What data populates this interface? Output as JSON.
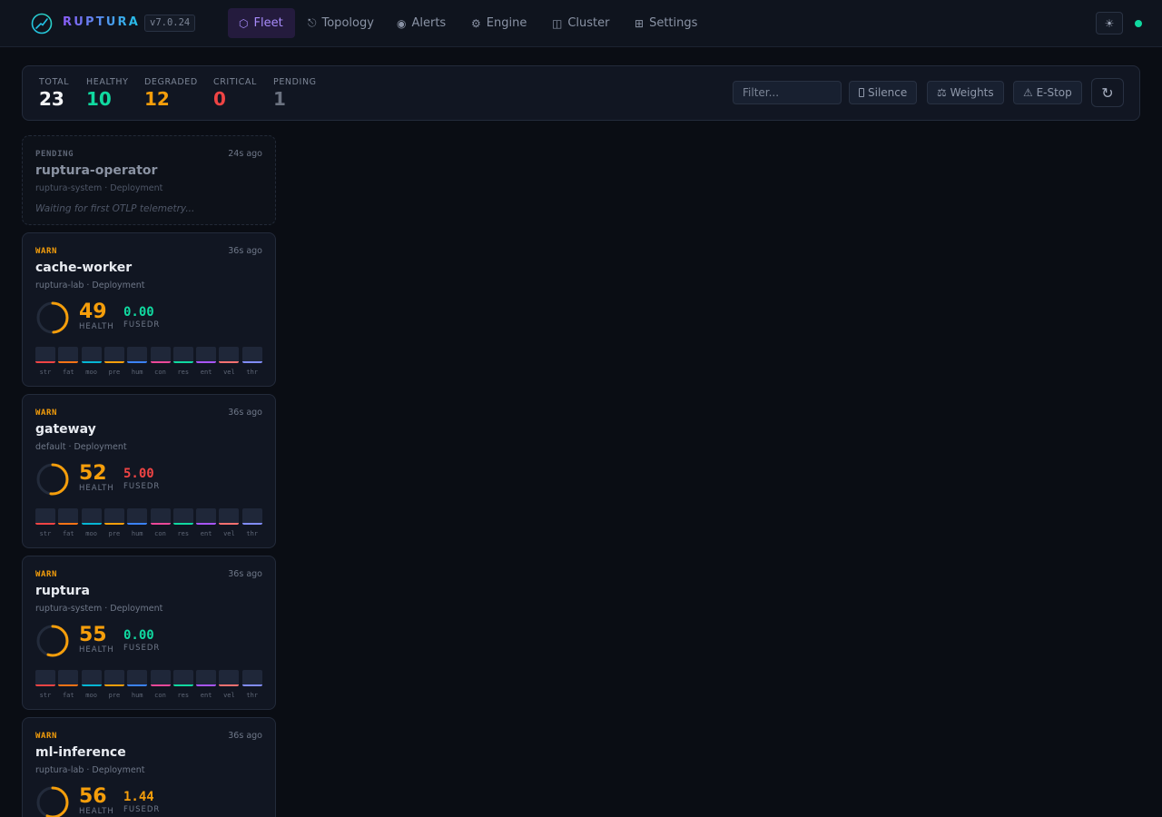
{
  "app": {
    "brand": "RUPTURA",
    "version": "v7.0.24"
  },
  "nav": [
    {
      "icon": "⬡",
      "label": "Fleet",
      "active": true
    },
    {
      "icon": "⎋",
      "label": "Topology"
    },
    {
      "icon": "◉",
      "label": "Alerts"
    },
    {
      "icon": "⚙",
      "label": "Engine"
    },
    {
      "icon": "◫",
      "label": "Cluster"
    },
    {
      "icon": "⊞",
      "label": "Settings"
    }
  ],
  "header_right": {
    "theme_icon": "☀",
    "status_color": "#10d9a0"
  },
  "summary": {
    "stats": [
      {
        "label": "TOTAL",
        "value": "23",
        "color": "#f3f4f6"
      },
      {
        "label": "HEALTHY",
        "value": "10",
        "color": "#10d9a0"
      },
      {
        "label": "DEGRADED",
        "value": "12",
        "color": "#f59e0b"
      },
      {
        "label": "CRITICAL",
        "value": "0",
        "color": "#ef4444"
      },
      {
        "label": "PENDING",
        "value": "1",
        "color": "#6b7280"
      }
    ],
    "filter_placeholder": "Filter...",
    "actions": {
      "silence": "Silence",
      "weights": "⚖ Weights",
      "estop": "⚠ E-Stop",
      "refresh": "↻"
    }
  },
  "signal_colors": [
    "#ef4444",
    "#f97316",
    "#06b6d4",
    "#f59e0b",
    "#3b82f6",
    "#ec4899",
    "#10d9a0",
    "#a855f7",
    "#f87171",
    "#818cf8"
  ],
  "signal_labels": [
    "str",
    "fat",
    "moo",
    "pre",
    "hum",
    "con",
    "res",
    "ent",
    "vel",
    "thr"
  ],
  "cards": [
    {
      "status": "PENDING",
      "pending": true,
      "name": "ruptura-operator",
      "meta": "ruptura-system · Deployment",
      "age": "24s ago",
      "message": "Waiting for first OTLP telemetry..."
    },
    {
      "status": "WARN",
      "name": "cache-worker",
      "meta": "ruptura-lab · Deployment",
      "age": "36s ago",
      "health": 49,
      "health_label": "HEALTH",
      "fusedr": "0.00",
      "fusedr_label": "FUSEDR",
      "fusedr_color": "#10d9a0"
    },
    {
      "status": "WARN",
      "name": "gateway",
      "meta": "default · Deployment",
      "age": "36s ago",
      "health": 52,
      "health_label": "HEALTH",
      "fusedr": "5.00",
      "fusedr_label": "FUSEDR",
      "fusedr_color": "#ef4444"
    },
    {
      "status": "WARN",
      "name": "ruptura",
      "meta": "ruptura-system · Deployment",
      "age": "36s ago",
      "health": 55,
      "health_label": "HEALTH",
      "fusedr": "0.00",
      "fusedr_label": "FUSEDR",
      "fusedr_color": "#10d9a0"
    },
    {
      "status": "WARN",
      "name": "ml-inference",
      "meta": "ruptura-lab · Deployment",
      "age": "36s ago",
      "health": 56,
      "health_label": "HEALTH",
      "fusedr": "1.44",
      "fusedr_label": "FUSEDR",
      "fusedr_color": "#f59e0b"
    }
  ],
  "warn_color": "#f59e0b"
}
